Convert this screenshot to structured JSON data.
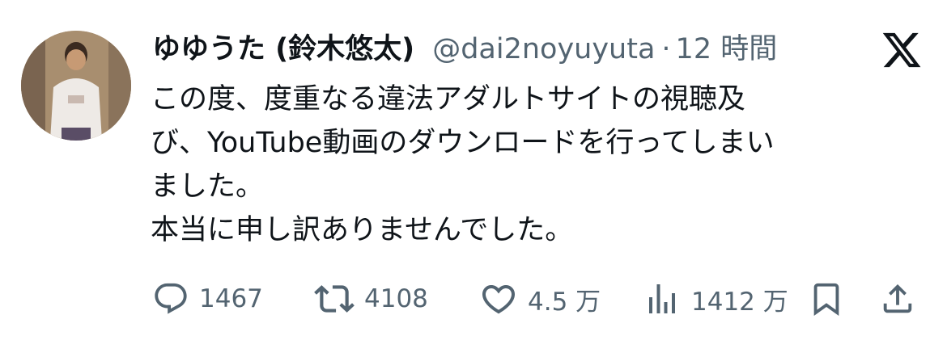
{
  "tweet": {
    "display_name": "ゆゆうた (鈴木悠太)",
    "handle": "@dai2noyuyuta",
    "separator": "·",
    "time": "12 時間",
    "lines": [
      "この度、度重なる違法アダルトサイトの視聴及",
      "び、YouTube動画のダウンロードを行ってしまい",
      "ました。",
      "本当に申し訳ありませんでした。"
    ]
  },
  "actions": {
    "reply": {
      "icon": "reply-icon",
      "count": "1467"
    },
    "retweet": {
      "icon": "retweet-icon",
      "count": "4108"
    },
    "like": {
      "icon": "heart-icon",
      "count": "4.5 万"
    },
    "views": {
      "icon": "views-chart-icon",
      "count": "1412 万"
    },
    "bookmark": {
      "icon": "bookmark-icon"
    },
    "share": {
      "icon": "share-icon"
    }
  },
  "colors": {
    "text_primary": "#0f1419",
    "text_secondary": "#536471",
    "background": "#ffffff"
  }
}
